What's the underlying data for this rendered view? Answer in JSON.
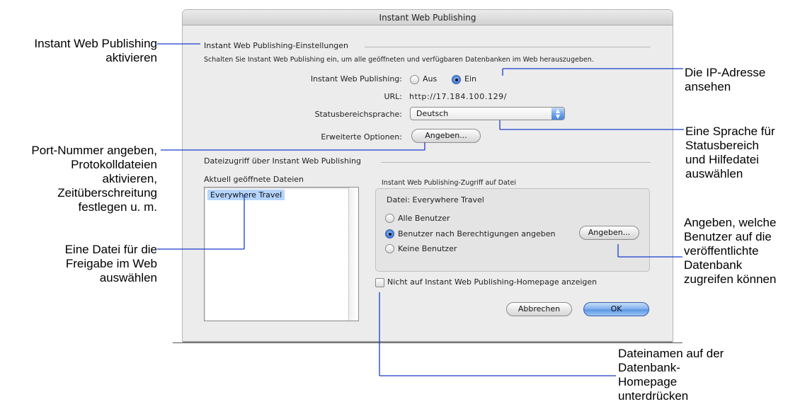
{
  "window": {
    "title": "Instant Web Publishing"
  },
  "settings": {
    "group_title": "Instant Web Publishing-Einstellungen",
    "description": "Schalten Sie Instant Web Publishing ein, um alle geöffneten und verfügbaren Datenbanken im Web herauszugeben.",
    "iwp_label": "Instant Web Publishing:",
    "radio_off": "Aus",
    "radio_on": "Ein",
    "selected": "Ein",
    "url_label": "URL:",
    "url_value": "http://17.184.100.129/",
    "language_label": "Statusbereichsprache:",
    "language_value": "Deutsch",
    "advanced_label": "Erweiterte Optionen:",
    "advanced_button": "Angeben..."
  },
  "file_access": {
    "group_title": "Dateizugriff über Instant Web Publishing",
    "list_label": "Aktuell geöffnete Dateien",
    "files": [
      "Everywhere Travel"
    ],
    "selected_file": "Everywhere Travel",
    "access_box_title": "Instant Web Publishing-Zugriff auf Datei",
    "file_line": "Datei: Everywhere Travel",
    "options": [
      "Alle Benutzer",
      "Benutzer nach Berechtigungen angeben",
      "Keine Benutzer"
    ],
    "selected_option": "Benutzer nach Berechtigungen angeben",
    "specify_button": "Angeben...",
    "hide_checkbox": "Nicht auf Instant Web Publishing-Homepage anzeigen",
    "hide_checked": false
  },
  "buttons": {
    "cancel": "Abbrechen",
    "ok": "OK"
  },
  "callouts": {
    "activate": [
      "Instant Web Publishing",
      "aktivieren"
    ],
    "port": [
      "Port-Nummer angeben,",
      "Protokolldateien",
      "aktivieren,",
      "Zeitüberschreitung",
      "festlegen u. m."
    ],
    "select_file": [
      "Eine Datei für die",
      "Freigabe im Web",
      "auswählen"
    ],
    "ip": [
      "Die IP-Adresse",
      "ansehen"
    ],
    "language": [
      "Eine Sprache für",
      "Statusbereich",
      "und Hilfedatei",
      "auswählen"
    ],
    "users": [
      "Angeben, welche",
      "Benutzer auf die",
      "veröffentlichte",
      "Datenbank",
      "zugreifen können"
    ],
    "hide": [
      "Dateinamen auf der",
      "Datenbank-",
      "Homepage",
      "unterdrücken"
    ]
  },
  "colors": {
    "leader_lines": "#1a3ccc",
    "selection": "#b5d5ff",
    "default_button": "#6aa0e8"
  }
}
